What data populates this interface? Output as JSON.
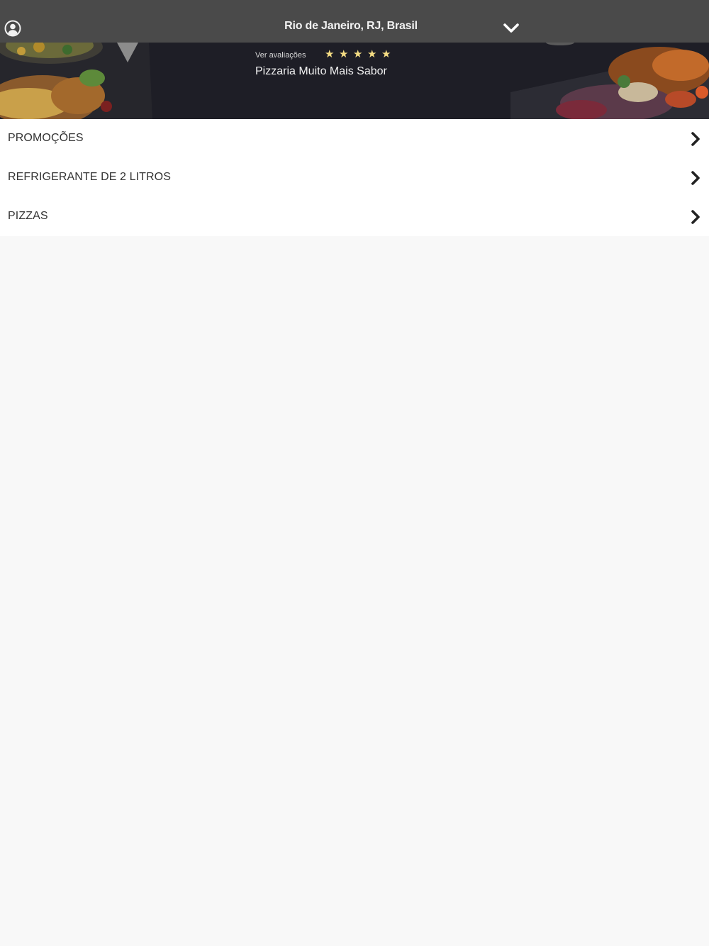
{
  "header": {
    "location": "Rio de Janeiro, RJ, Brasil",
    "account_icon": "user-circle-icon",
    "location_toggle_icon": "chevron-down-icon"
  },
  "store": {
    "reviews_link": "Ver avaliações",
    "rating": 5,
    "rating_max": 5,
    "star_icon": "★",
    "star_color": "#f5dd84",
    "name": "Pizzaria Muito Mais Sabor"
  },
  "categories": [
    {
      "label": "PROMOÇÕES"
    },
    {
      "label": "REFRIGERANTE DE 2 LITROS"
    },
    {
      "label": "PIZZAS"
    }
  ],
  "colors": {
    "topbar": "#4a4a4a",
    "background": "#f8f8f8",
    "list_background": "#ffffff",
    "text": "#333333"
  }
}
